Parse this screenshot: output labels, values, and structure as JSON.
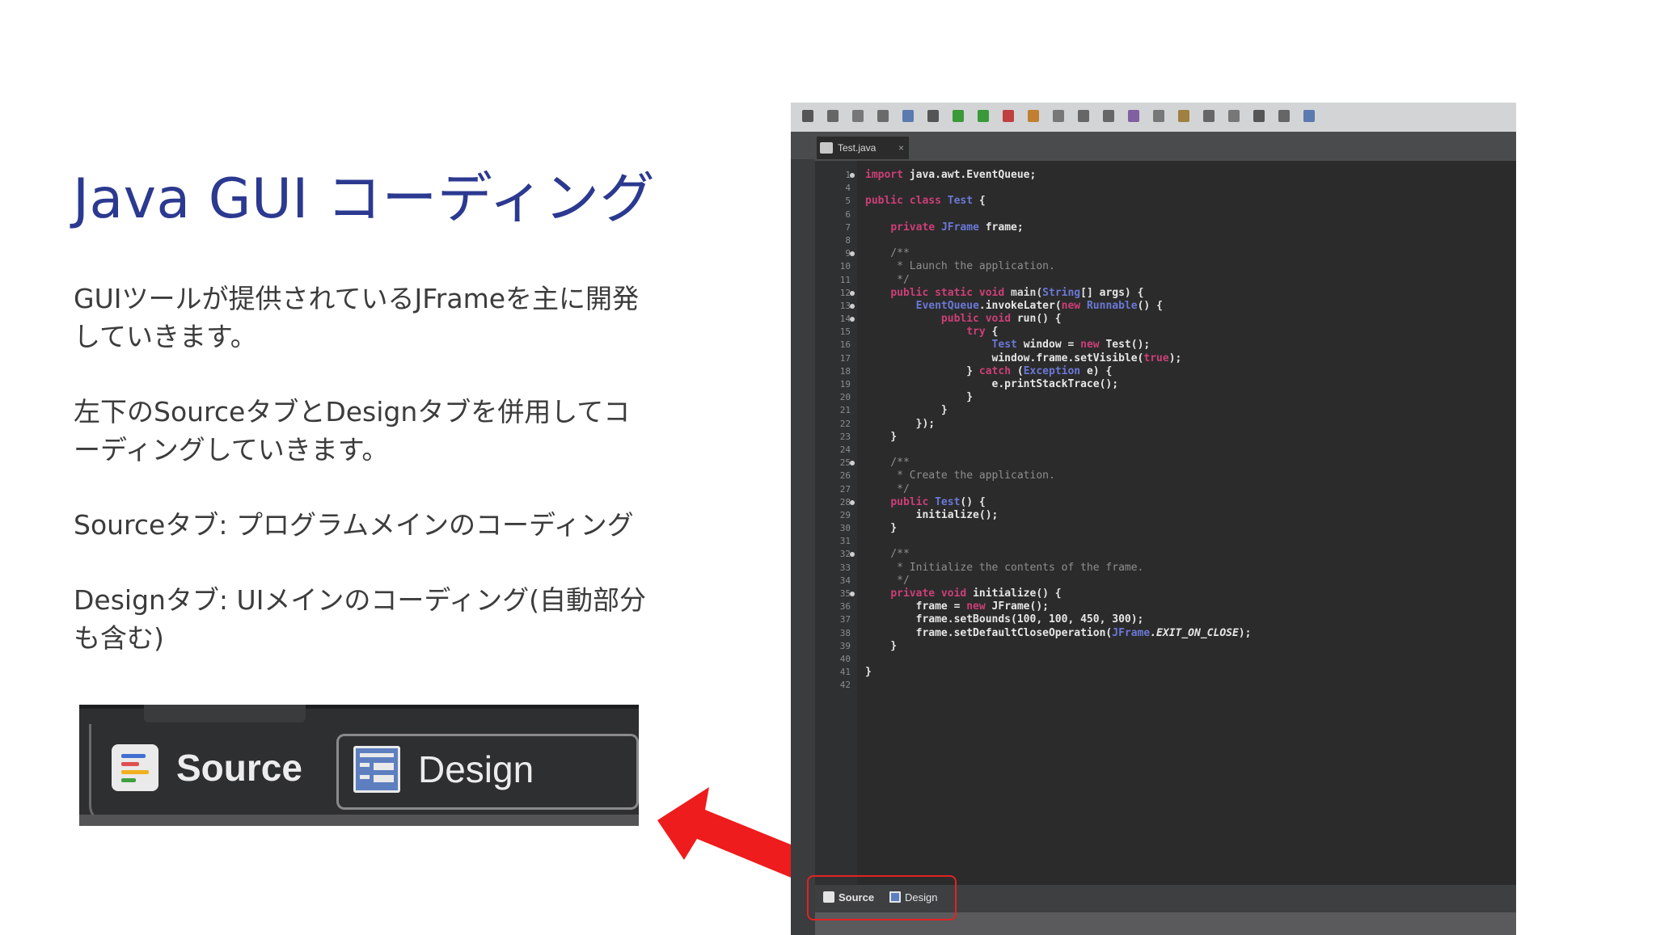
{
  "slide": {
    "title": "Java GUI コーディング",
    "paragraphs": [
      "GUIツールが提供されているJFrameを主に開発していきます。",
      "左下のSourceタブとDesignタブを併用してコーディングしていきます。",
      "Sourceタブ: プログラムメインのコーディング",
      "Designタブ: UIメインのコーディング(自動部分も含む)"
    ]
  },
  "zoom_tabs": {
    "source_label": "Source",
    "design_label": "Design"
  },
  "ide": {
    "file_tab": "Test.java",
    "bottom_tabs": {
      "source_label": "Source",
      "design_label": "Design"
    },
    "code": [
      {
        "ln": "1",
        "mk": true,
        "t": [
          [
            "kw",
            "import "
          ],
          [
            "",
            "java.awt.EventQueue;"
          ]
        ]
      },
      {
        "ln": "4",
        "mk": false,
        "t": []
      },
      {
        "ln": "5",
        "mk": false,
        "t": [
          [
            "kw",
            "public class "
          ],
          [
            "ty",
            "Test"
          ],
          [
            "",
            " {"
          ]
        ]
      },
      {
        "ln": "6",
        "mk": false,
        "t": []
      },
      {
        "ln": "7",
        "mk": false,
        "t": [
          [
            "",
            "    "
          ],
          [
            "kw",
            "private "
          ],
          [
            "ty",
            "JFrame "
          ],
          [
            "",
            "frame;"
          ]
        ]
      },
      {
        "ln": "8",
        "mk": false,
        "t": []
      },
      {
        "ln": "9",
        "mk": true,
        "t": [
          [
            "cm",
            "    /**"
          ]
        ]
      },
      {
        "ln": "10",
        "mk": false,
        "t": [
          [
            "cm",
            "     * Launch the application."
          ]
        ]
      },
      {
        "ln": "11",
        "mk": false,
        "t": [
          [
            "cm",
            "     */"
          ]
        ]
      },
      {
        "ln": "12",
        "mk": true,
        "t": [
          [
            "",
            "    "
          ],
          [
            "kw",
            "public static void "
          ],
          [
            "fn",
            "main("
          ],
          [
            "ty",
            "String"
          ],
          [
            "",
            "[] args) {"
          ]
        ]
      },
      {
        "ln": "13",
        "mk": true,
        "t": [
          [
            "",
            "        "
          ],
          [
            "ty",
            "EventQueue"
          ],
          [
            "",
            ".invokeLater("
          ],
          [
            "kw",
            "new "
          ],
          [
            "ty",
            "Runnable"
          ],
          [
            "",
            "() {"
          ]
        ]
      },
      {
        "ln": "14",
        "mk": true,
        "t": [
          [
            "",
            "            "
          ],
          [
            "kw",
            "public void "
          ],
          [
            "",
            "run() {"
          ]
        ]
      },
      {
        "ln": "15",
        "mk": false,
        "t": [
          [
            "",
            "                "
          ],
          [
            "kw",
            "try"
          ],
          [
            "",
            " {"
          ]
        ]
      },
      {
        "ln": "16",
        "mk": false,
        "t": [
          [
            "",
            "                    "
          ],
          [
            "ty",
            "Test "
          ],
          [
            "",
            "window = "
          ],
          [
            "kw",
            "new "
          ],
          [
            "",
            "Test();"
          ]
        ]
      },
      {
        "ln": "17",
        "mk": false,
        "t": [
          [
            "",
            "                    window.frame.setVisible("
          ],
          [
            "kw",
            "true"
          ],
          [
            "",
            ");"
          ]
        ]
      },
      {
        "ln": "18",
        "mk": false,
        "t": [
          [
            "",
            "                } "
          ],
          [
            "kw",
            "catch "
          ],
          [
            "",
            "("
          ],
          [
            "ty",
            "Exception "
          ],
          [
            "",
            "e) {"
          ]
        ]
      },
      {
        "ln": "19",
        "mk": false,
        "t": [
          [
            "",
            "                    e.printStackTrace();"
          ]
        ]
      },
      {
        "ln": "20",
        "mk": false,
        "t": [
          [
            "",
            "                }"
          ]
        ]
      },
      {
        "ln": "21",
        "mk": false,
        "t": [
          [
            "",
            "            }"
          ]
        ]
      },
      {
        "ln": "22",
        "mk": false,
        "t": [
          [
            "",
            "        });"
          ]
        ]
      },
      {
        "ln": "23",
        "mk": false,
        "t": [
          [
            "",
            "    }"
          ]
        ]
      },
      {
        "ln": "24",
        "mk": false,
        "t": []
      },
      {
        "ln": "25",
        "mk": true,
        "t": [
          [
            "cm",
            "    /**"
          ]
        ]
      },
      {
        "ln": "26",
        "mk": false,
        "t": [
          [
            "cm",
            "     * Create the application."
          ]
        ]
      },
      {
        "ln": "27",
        "mk": false,
        "t": [
          [
            "cm",
            "     */"
          ]
        ]
      },
      {
        "ln": "28",
        "mk": true,
        "t": [
          [
            "",
            "    "
          ],
          [
            "kw",
            "public "
          ],
          [
            "ty",
            "Test"
          ],
          [
            "",
            "() {"
          ]
        ]
      },
      {
        "ln": "29",
        "mk": false,
        "t": [
          [
            "",
            "        initialize();"
          ]
        ]
      },
      {
        "ln": "30",
        "mk": false,
        "t": [
          [
            "",
            "    }"
          ]
        ]
      },
      {
        "ln": "31",
        "mk": false,
        "t": []
      },
      {
        "ln": "32",
        "mk": true,
        "t": [
          [
            "cm",
            "    /**"
          ]
        ]
      },
      {
        "ln": "33",
        "mk": false,
        "t": [
          [
            "cm",
            "     * Initialize the contents of the frame."
          ]
        ]
      },
      {
        "ln": "34",
        "mk": false,
        "t": [
          [
            "cm",
            "     */"
          ]
        ]
      },
      {
        "ln": "35",
        "mk": true,
        "t": [
          [
            "",
            "    "
          ],
          [
            "kw",
            "private void "
          ],
          [
            "",
            "initialize() {"
          ]
        ]
      },
      {
        "ln": "36",
        "mk": false,
        "t": [
          [
            "",
            "        frame = "
          ],
          [
            "kw",
            "new "
          ],
          [
            "",
            "JFrame();"
          ]
        ]
      },
      {
        "ln": "37",
        "mk": false,
        "t": [
          [
            "",
            "        frame.setBounds(100, 100, 450, 300);"
          ]
        ]
      },
      {
        "ln": "38",
        "mk": false,
        "t": [
          [
            "",
            "        frame.setDefaultCloseOperation("
          ],
          [
            "ty",
            "JFrame"
          ],
          [
            "it",
            "."
          ],
          [
            "it",
            "EXIT_ON_CLOSE"
          ],
          [
            "",
            ");"
          ]
        ]
      },
      {
        "ln": "39",
        "mk": false,
        "t": [
          [
            "",
            "    }"
          ]
        ]
      },
      {
        "ln": "40",
        "mk": false,
        "t": []
      },
      {
        "ln": "41",
        "mk": false,
        "t": [
          [
            "",
            "}"
          ]
        ]
      },
      {
        "ln": "42",
        "mk": false,
        "t": []
      }
    ]
  },
  "colors": {
    "title": "#2b3990",
    "arrow": "#ee1c1c",
    "highlight": "#e02323",
    "keyword": "#cc3f77",
    "type": "#6a78d6"
  }
}
